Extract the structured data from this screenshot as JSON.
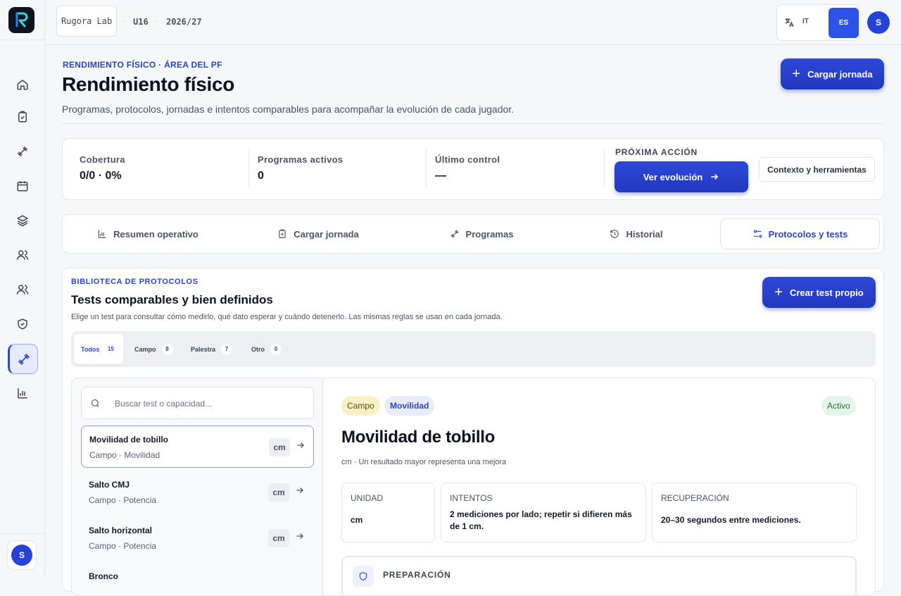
{
  "sidebar": {
    "logo_icon": "rugora-logo",
    "items": [
      {
        "name": "home-icon"
      },
      {
        "name": "clipboard-icon"
      },
      {
        "name": "dumbbell-icon"
      },
      {
        "name": "calendar-icon"
      },
      {
        "name": "layers-icon"
      },
      {
        "name": "users-icon"
      },
      {
        "name": "team-icon"
      },
      {
        "name": "shield-icon"
      },
      {
        "name": "dumbbell-icon",
        "active": true
      },
      {
        "name": "bar-chart-icon"
      }
    ],
    "avatar": "S"
  },
  "topbar": {
    "org": "Rugora Lab",
    "category": "U16",
    "season": "2026/27",
    "lang_it": "IT",
    "lang_es": "ES",
    "avatar": "S"
  },
  "header": {
    "eyebrow": "RENDIMIENTO FÍSICO · ÁREA DEL PF",
    "title": "Rendimiento físico",
    "subtitle": "Programas, protocolos, jornadas e intentos comparables para acompañar la evolución de cada jugador.",
    "primary_action": "Cargar jornada"
  },
  "stats": {
    "coverage_label": "Cobertura",
    "coverage_value": "0/0 · 0%",
    "programs_label": "Programas activos",
    "programs_value": "0",
    "last_label": "Último control",
    "last_value": "—",
    "next_label": "PRÓXIMA ACCIÓN",
    "next_button": "Ver evolución",
    "context_button": "Contexto y herramientas"
  },
  "tabs": [
    {
      "label": "Resumen operativo"
    },
    {
      "label": "Cargar jornada"
    },
    {
      "label": "Programas"
    },
    {
      "label": "Historial"
    },
    {
      "label": "Protocolos y tests",
      "active": true
    }
  ],
  "library": {
    "eyebrow": "BIBLIOTECA DE PROTOCOLOS",
    "title": "Tests comparables y bien definidos",
    "subtitle": "Elige un test para consultar cómo medirlo, qué dato esperar y cuándo detenerlo. Las mismas reglas se usan en cada jornada.",
    "create_button": "Crear test propio",
    "filters": [
      {
        "label": "Todos",
        "count": "15",
        "active": true
      },
      {
        "label": "Campo",
        "count": "8"
      },
      {
        "label": "Palestra",
        "count": "7"
      },
      {
        "label": "Otro",
        "count": "0"
      }
    ],
    "search_placeholder": "Buscar test o capacidad...",
    "tests": [
      {
        "name": "Movilidad de tobillo",
        "meta": "Campo · Movilidad",
        "unit": "cm",
        "selected": true
      },
      {
        "name": "Salto CMJ",
        "meta": "Campo · Potencia",
        "unit": "cm"
      },
      {
        "name": "Salto horizontal",
        "meta": "Campo · Potencia",
        "unit": "cm"
      },
      {
        "name": "Bronco",
        "meta": "",
        "unit": ""
      }
    ]
  },
  "detail": {
    "tag_place": "Campo",
    "tag_capacity": "Movilidad",
    "status": "Activo",
    "title": "Movilidad de tobillo",
    "subtitle": "cm · Un resultado mayor representa una mejora",
    "unit_label": "UNIDAD",
    "unit_value": "cm",
    "attempts_label": "INTENTOS",
    "attempts_value": "2 mediciones por lado; repetir si difieren más de 1 cm.",
    "recovery_label": "RECUPERACIÓN",
    "recovery_value": "20–30 segundos entre mediciones.",
    "prep_label": "PREPARACIÓN"
  },
  "colors": {
    "accent": "#2a44c8",
    "primary_button": "#2238c0",
    "tag_place_bg": "#fbf0c4",
    "tag_capacity_bg": "#e8ecfb",
    "status_bg": "#e6f5ea"
  }
}
